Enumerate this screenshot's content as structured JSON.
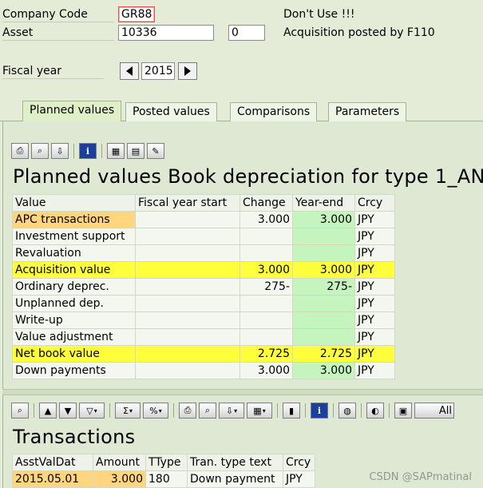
{
  "header": {
    "company_code_label": "Company Code",
    "company_code_value": "GR88",
    "asset_label": "Asset",
    "asset_value": "10336",
    "sub_number": "0",
    "dont_use": "Don't Use !!!",
    "acq_posted": "Acquisition posted by F110",
    "fiscal_year_label": "Fiscal year",
    "fiscal_year_value": "2015"
  },
  "tabs": [
    {
      "label": "Planned values",
      "active": true
    },
    {
      "label": "Posted values",
      "active": false
    },
    {
      "label": "Comparisons",
      "active": false
    },
    {
      "label": "Parameters",
      "active": false
    }
  ],
  "planned": {
    "title": "Planned values Book depreciation for type 1_AN",
    "columns": [
      "Value",
      "Fiscal year start",
      "Change",
      "Year-end",
      "Crcy"
    ],
    "rows": [
      {
        "value": "APC transactions",
        "start": "",
        "change": "3.000",
        "yearend": "3.000",
        "crcy": "JPY",
        "style": "orange"
      },
      {
        "value": "Investment support",
        "start": "",
        "change": "",
        "yearend": "",
        "crcy": "JPY",
        "style": "normal"
      },
      {
        "value": "Revaluation",
        "start": "",
        "change": "",
        "yearend": "",
        "crcy": "JPY",
        "style": "normal"
      },
      {
        "value": "Acquisition value",
        "start": "",
        "change": "3.000",
        "yearend": "3.000",
        "crcy": "JPY",
        "style": "yellow"
      },
      {
        "value": "Ordinary deprec.",
        "start": "",
        "change": "275-",
        "yearend": "275-",
        "crcy": "JPY",
        "style": "normal"
      },
      {
        "value": "Unplanned dep.",
        "start": "",
        "change": "",
        "yearend": "",
        "crcy": "JPY",
        "style": "normal"
      },
      {
        "value": "Write-up",
        "start": "",
        "change": "",
        "yearend": "",
        "crcy": "JPY",
        "style": "normal"
      },
      {
        "value": "Value adjustment",
        "start": "",
        "change": "",
        "yearend": "",
        "crcy": "JPY",
        "style": "normal"
      },
      {
        "value": "Net book value",
        "start": "",
        "change": "2.725",
        "yearend": "2.725",
        "crcy": "JPY",
        "style": "yellow"
      },
      {
        "value": "Down payments",
        "start": "",
        "change": "3.000",
        "yearend": "3.000",
        "crcy": "JPY",
        "style": "normal"
      }
    ]
  },
  "transactions": {
    "title": "Transactions",
    "columns": [
      "AsstValDat",
      "Amount",
      "TType",
      "Tran. type text",
      "Crcy"
    ],
    "rows": [
      {
        "date": "2015.05.01",
        "amount": "3.000",
        "ttype": "180",
        "text": "Down payment",
        "crcy": "JPY"
      }
    ]
  },
  "toolbar2_all_label": "All",
  "watermark": "CSDN @SAPmatinal",
  "colors": {
    "yellow": "#ffff3c",
    "green": "#c6f4bf",
    "orange": "#ffd580",
    "background": "#e4ecd8"
  }
}
